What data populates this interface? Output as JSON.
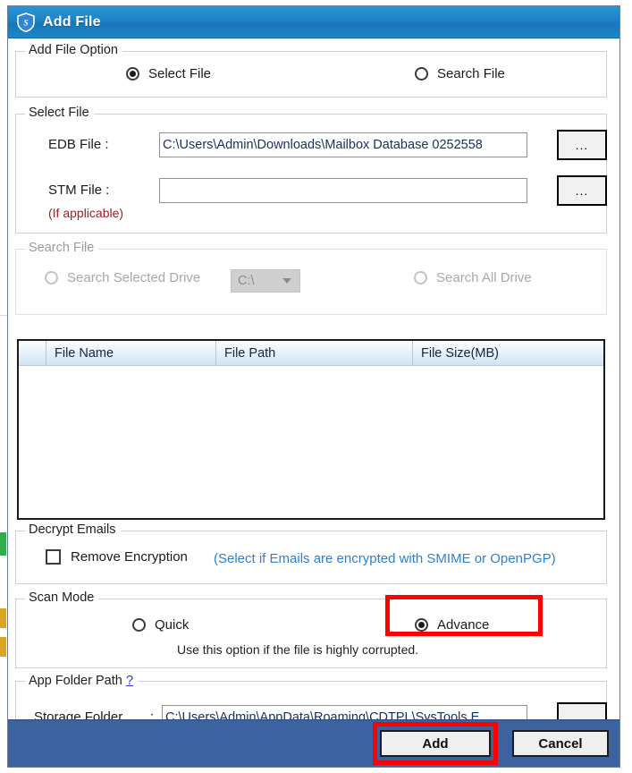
{
  "window": {
    "title": "Add File",
    "icon": "shield-icon"
  },
  "add_file_option": {
    "legend": "Add File Option",
    "options": [
      {
        "label": "Select File",
        "selected": true
      },
      {
        "label": "Search File",
        "selected": false
      }
    ]
  },
  "select_file": {
    "legend": "Select File",
    "edb_label": "EDB File :",
    "edb_value": "C:\\Users\\Admin\\Downloads\\Mailbox Database 0252558",
    "edb_browse": "...",
    "stm_label": "STM File :",
    "stm_value": "",
    "stm_placeholder": "",
    "stm_note": "(If applicable)",
    "stm_browse": "..."
  },
  "search_file": {
    "legend": "Search File",
    "search_selected_drive": "Search Selected Drive",
    "drive_value": "C:\\",
    "search_all_drive": "Search All Drive",
    "disabled": true
  },
  "file_list": {
    "columns": [
      "File Name",
      "File Path",
      "File Size(MB)"
    ],
    "rows": []
  },
  "decrypt_emails": {
    "legend": "Decrypt Emails",
    "checkbox_label": "Remove Encryption",
    "checked": false,
    "hint": "(Select if Emails are encrypted with SMIME or OpenPGP)",
    "hint_color": "#2f7fd1"
  },
  "scan_mode": {
    "legend": "Scan Mode",
    "options": [
      {
        "label": "Quick",
        "selected": false
      },
      {
        "label": "Advance",
        "selected": true
      }
    ],
    "note": "Use this option if the file is highly corrupted.",
    "highlight_color": "#ff0000"
  },
  "app_folder_path": {
    "legend": "App Folder Path",
    "help": "?",
    "storage_label": "Storage Folder",
    "storage_colon": ":",
    "storage_value": "C:\\Users\\Admin\\AppData\\Roaming\\CDTPL\\SysTools E",
    "storage_browse": "..."
  },
  "footer": {
    "add_label": "Add",
    "cancel_label": "Cancel",
    "bar_color": "#3d62a0",
    "highlight_color": "#ff0000"
  }
}
